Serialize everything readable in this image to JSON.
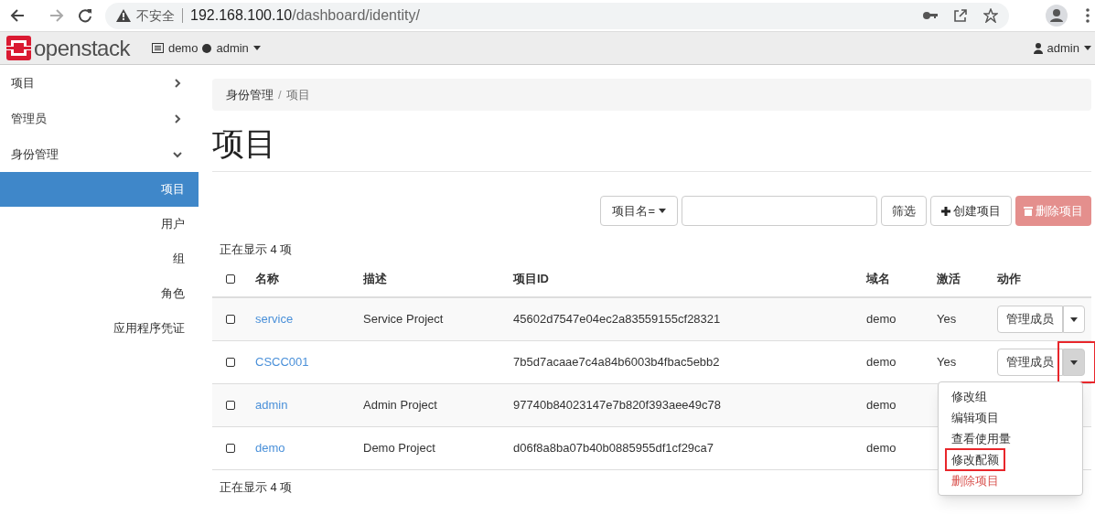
{
  "browser": {
    "security_label": "不安全",
    "url_host": "192.168.100.10",
    "url_path": "/dashboard/identity/"
  },
  "navbar": {
    "logo": "openstack",
    "project": "demo",
    "user_context": "admin",
    "user_menu": "admin"
  },
  "sidebar": {
    "items": [
      {
        "label": "项目",
        "expanded": false
      },
      {
        "label": "管理员",
        "expanded": false
      },
      {
        "label": "身份管理",
        "expanded": true,
        "children": [
          {
            "label": "项目",
            "selected": true
          },
          {
            "label": "用户",
            "selected": false
          },
          {
            "label": "组",
            "selected": false
          },
          {
            "label": "角色",
            "selected": false
          },
          {
            "label": "应用程序凭证",
            "selected": false
          }
        ]
      }
    ]
  },
  "breadcrumb": [
    "身份管理",
    "项目"
  ],
  "breadcrumb_separator": "/",
  "select_all_checked": false,
  "title": "项目",
  "toolbar": {
    "filter_field": "项目名=",
    "filter_button": "筛选",
    "create_button": "创建项目",
    "delete_button": {
      "label": "删除项目",
      "disabled": true
    }
  },
  "count_top": "正在显示 4 项",
  "table": {
    "columns": [
      "名称",
      "描述",
      "项目ID",
      "域名",
      "激活",
      "动作"
    ],
    "rows": [
      {
        "name": "service",
        "description": "Service Project",
        "id": "45602d7547e04ec2a83559155cf28321",
        "domain": "demo",
        "active": "Yes",
        "action": "管理成员",
        "menu_open": false,
        "highlighted": false,
        "checked": false
      },
      {
        "name": "CSCC001",
        "description": "",
        "id": "7b5d7acaae7c4a84b6003b4fbac5ebb2",
        "domain": "demo",
        "active": "Yes",
        "action": "管理成员",
        "menu_open": true,
        "highlighted": true,
        "checked": false
      },
      {
        "name": "admin",
        "description": "Admin Project",
        "id": "97740b84023147e7b820f393aee49c78",
        "domain": "demo",
        "checked": false
      },
      {
        "name": "demo",
        "description": "Demo Project",
        "id": "d06f8a8ba07b40b0885955df1cf29ca7",
        "domain": "demo",
        "checked": false
      }
    ]
  },
  "count_bottom": "正在显示 4 项",
  "menu": {
    "items": [
      {
        "label": "修改组",
        "kind": "normal",
        "highlighted": false
      },
      {
        "label": "编辑项目",
        "kind": "normal",
        "highlighted": false
      },
      {
        "label": "查看使用量",
        "kind": "normal",
        "highlighted": false
      },
      {
        "label": "修改配额",
        "kind": "normal",
        "highlighted": true
      },
      {
        "label": "删除项目",
        "kind": "danger",
        "highlighted": false
      }
    ]
  }
}
